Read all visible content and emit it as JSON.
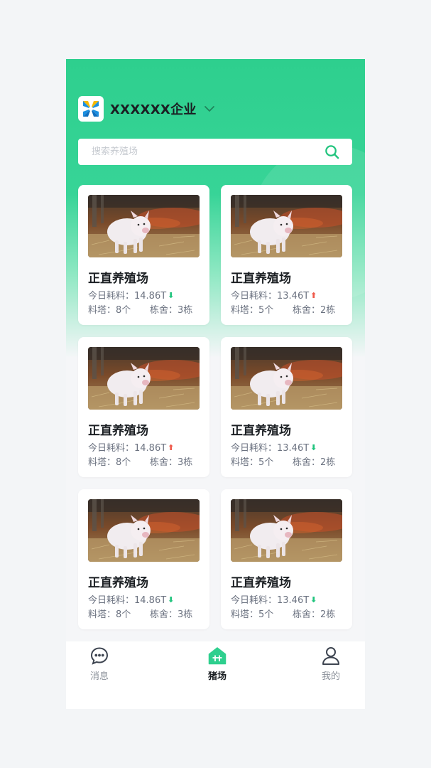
{
  "header": {
    "company_name": "XXXXXX企业"
  },
  "search": {
    "placeholder": "搜索养殖场",
    "value": ""
  },
  "colors": {
    "brand_green": "#2ecf8e",
    "arrow_down": "#22c47e",
    "arrow_up": "#ef5b4c"
  },
  "farms": [
    {
      "name": "正直养殖场",
      "consumption": "今日耗料：14.86T",
      "trend": "down",
      "towers": "料塔：8个",
      "barns": "栋舍：3栋"
    },
    {
      "name": "正直养殖场",
      "consumption": "今日耗料：13.46T",
      "trend": "up",
      "towers": "料塔：5个",
      "barns": "栋舍：2栋"
    },
    {
      "name": "正直养殖场",
      "consumption": "今日耗料：14.86T",
      "trend": "up",
      "towers": "料塔：8个",
      "barns": "栋舍：3栋"
    },
    {
      "name": "正直养殖场",
      "consumption": "今日耗料：13.46T",
      "trend": "down",
      "towers": "料塔：5个",
      "barns": "栋舍：2栋"
    },
    {
      "name": "正直养殖场",
      "consumption": "今日耗料：14.86T",
      "trend": "down",
      "towers": "料塔：8个",
      "barns": "栋舍：3栋"
    },
    {
      "name": "正直养殖场",
      "consumption": "今日耗料：13.46T",
      "trend": "down",
      "towers": "料塔：5个",
      "barns": "栋舍：2栋"
    }
  ],
  "tabbar": {
    "items": [
      {
        "label": "消息",
        "icon": "message-icon",
        "active": false
      },
      {
        "label": "猪场",
        "icon": "farm-icon",
        "active": true
      },
      {
        "label": "我的",
        "icon": "user-icon",
        "active": false
      }
    ]
  }
}
